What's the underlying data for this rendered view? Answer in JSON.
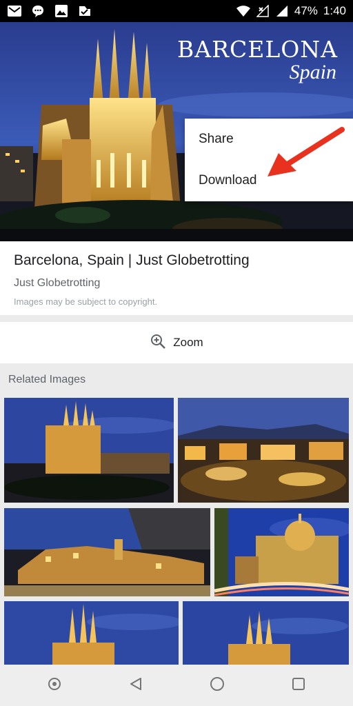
{
  "status_bar": {
    "icons_left": [
      "gmail-icon",
      "messages-icon",
      "photos-icon",
      "check-badge-icon"
    ],
    "icons_right": [
      "wifi-icon",
      "signal-off-icon",
      "signal-icon"
    ],
    "battery": "47%",
    "time": "1:40"
  },
  "hero": {
    "overlay_title": "BARCELONA",
    "overlay_subtitle": "Spain"
  },
  "menu": {
    "items": [
      {
        "label": "Share"
      },
      {
        "label": "Download"
      }
    ],
    "annotation_color": "#e8311f"
  },
  "info": {
    "title": "Barcelona, Spain | Just Globetrotting",
    "source": "Just Globetrotting",
    "note": "Images may be subject to copyright."
  },
  "zoom": {
    "label": "Zoom",
    "icon": "zoom-in-icon"
  },
  "related": {
    "heading": "Related Images"
  },
  "nav": {
    "icons": [
      "assistant-icon",
      "back-icon",
      "home-icon",
      "recents-icon"
    ]
  },
  "colors": {
    "status_bg": "#000000",
    "page_bg": "#ebebeb",
    "text_primary": "#202124",
    "text_secondary": "#5f6368"
  }
}
